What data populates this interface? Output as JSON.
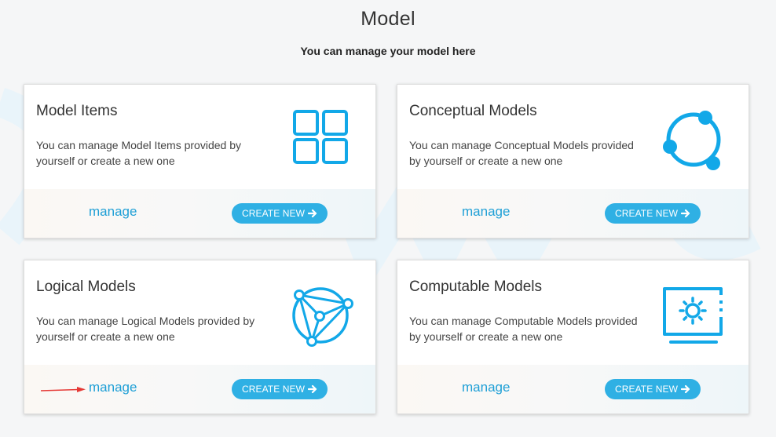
{
  "page": {
    "title": "Model",
    "subtitle": "You can manage your model here"
  },
  "cards": [
    {
      "title": "Model Items",
      "description": "You can manage Model Items provided by yourself or create a new one",
      "icon": "grid-icon",
      "manage_label": "manage",
      "create_label": "CREATE NEW"
    },
    {
      "title": "Conceptual Models",
      "description": "You can manage Conceptual Models provided by yourself or create a new one",
      "icon": "circle-nodes-icon",
      "manage_label": "manage",
      "create_label": "CREATE NEW"
    },
    {
      "title": "Logical Models",
      "description": "You can manage Logical Models provided by yourself or create a new one",
      "icon": "network-icon",
      "manage_label": "manage",
      "create_label": "CREATE NEW"
    },
    {
      "title": "Computable Models",
      "description": "You can manage Computable Models provided by yourself or create a new one",
      "icon": "monitor-gear-icon",
      "manage_label": "manage",
      "create_label": "CREATE NEW"
    }
  ],
  "colors": {
    "accent": "#1e9fd6",
    "button": "#2fb0e4",
    "icon": "#12a8e8",
    "annotation_arrow": "#e53935"
  }
}
